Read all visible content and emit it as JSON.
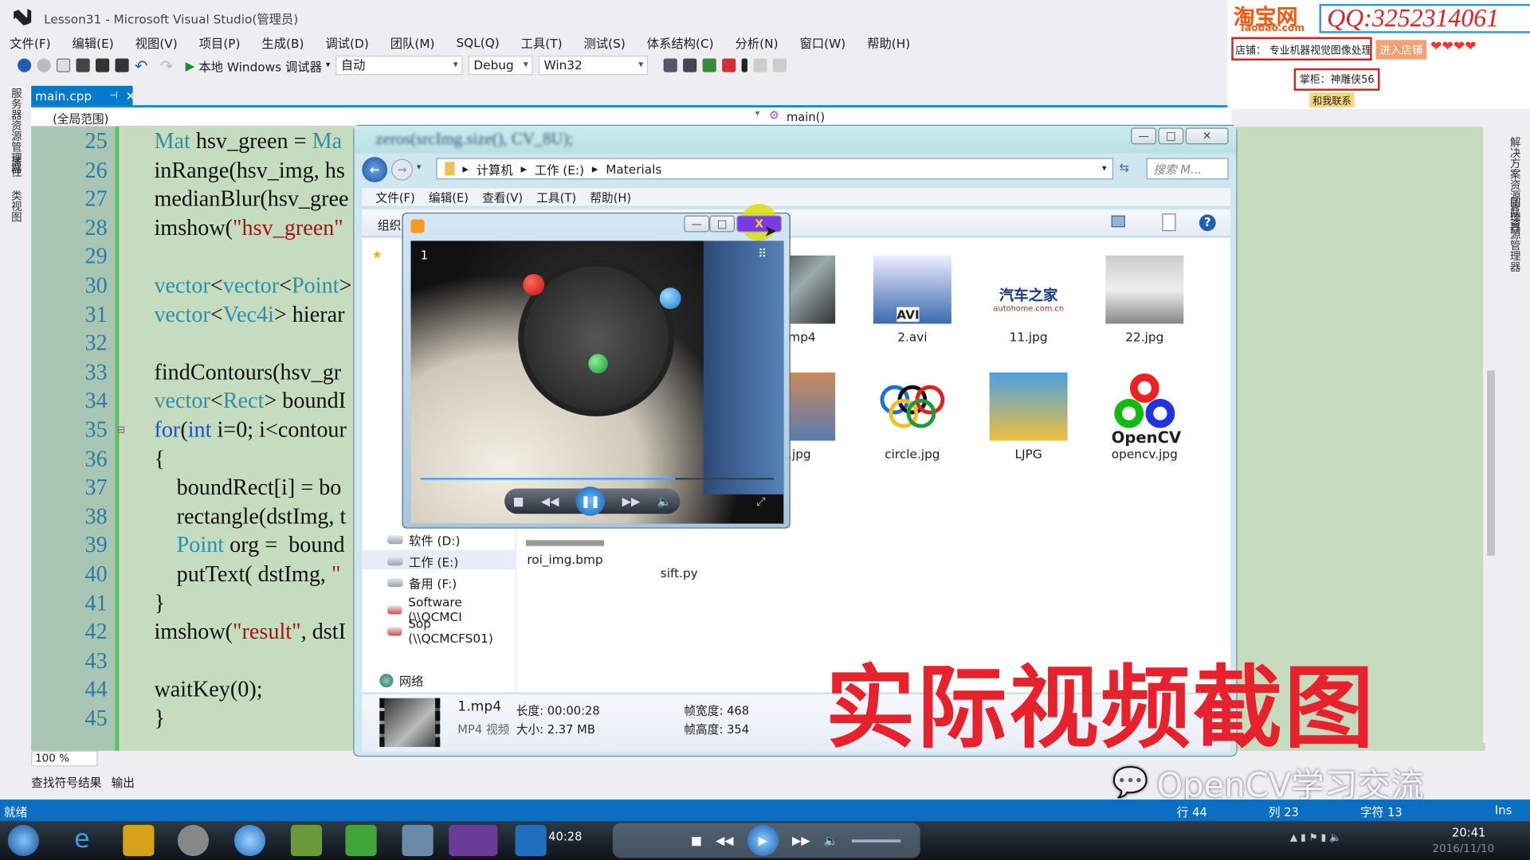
{
  "window": {
    "title": "Lesson31 - Microsoft Visual Studio(管理员)"
  },
  "menu": [
    "文件(F)",
    "编辑(E)",
    "视图(V)",
    "项目(P)",
    "生成(B)",
    "调试(D)",
    "团队(M)",
    "SQL(Q)",
    "工具(T)",
    "测试(S)",
    "体系结构(C)",
    "分析(N)",
    "窗口(W)",
    "帮助(H)"
  ],
  "toolbar": {
    "debugger_label": "本地 Windows 调试器",
    "config_combo": "自动",
    "build_combo": "Debug",
    "platform_combo": "Win32"
  },
  "doc_tab": {
    "label": "main.cpp",
    "pin": "⊣",
    "close": "✕"
  },
  "navbar": {
    "scope": "(全局范围)",
    "member": "main()"
  },
  "left_tabs": [
    "服务器资源管理器",
    "属性",
    "类视图"
  ],
  "right_tabs": [
    "解决方案资源管理器",
    "团队资源管理器",
    "类视图"
  ],
  "editor": {
    "lines": [
      {
        "n": "25",
        "segs": [
          [
            "Mat",
            "ty"
          ],
          [
            " hsv_green = ",
            ""
          ],
          [
            "Ma",
            "ty"
          ]
        ]
      },
      {
        "n": "26",
        "segs": [
          [
            "inRange(hsv_img, hs",
            ""
          ]
        ]
      },
      {
        "n": "27",
        "segs": [
          [
            "medianBlur(hsv_gree",
            ""
          ]
        ]
      },
      {
        "n": "28",
        "segs": [
          [
            "imshow(",
            ""
          ],
          [
            "\"hsv_green\"",
            "st"
          ]
        ]
      },
      {
        "n": "29",
        "segs": []
      },
      {
        "n": "30",
        "segs": [
          [
            "vector",
            "ty"
          ],
          [
            "<",
            ""
          ],
          [
            "vector",
            "ty"
          ],
          [
            "<",
            ""
          ],
          [
            "Point",
            "ty"
          ],
          [
            ">",
            ""
          ]
        ]
      },
      {
        "n": "31",
        "segs": [
          [
            "vector",
            "ty"
          ],
          [
            "<",
            ""
          ],
          [
            "Vec4i",
            "ty"
          ],
          [
            "> hierar",
            ""
          ]
        ]
      },
      {
        "n": "32",
        "segs": []
      },
      {
        "n": "33",
        "segs": [
          [
            "findContours(hsv_gr",
            ""
          ]
        ]
      },
      {
        "n": "34",
        "segs": [
          [
            "vector",
            "ty"
          ],
          [
            "<",
            ""
          ],
          [
            "Rect",
            "ty"
          ],
          [
            "> boundI",
            ""
          ]
        ]
      },
      {
        "n": "35",
        "segs": [
          [
            "for",
            "kw"
          ],
          [
            "(",
            ""
          ],
          [
            "int",
            "kw"
          ],
          [
            " i=0; i<contour",
            ""
          ]
        ]
      },
      {
        "n": "36",
        "segs": [
          [
            "{",
            ""
          ]
        ]
      },
      {
        "n": "37",
        "segs": [
          [
            "    boundRect[i] = bo",
            ""
          ]
        ]
      },
      {
        "n": "38",
        "segs": [
          [
            "    rectangle(dstImg, t",
            ""
          ]
        ]
      },
      {
        "n": "39",
        "segs": [
          [
            "    ",
            ""
          ],
          [
            "Point",
            "ty"
          ],
          [
            " org =  bound",
            ""
          ]
        ]
      },
      {
        "n": "40",
        "segs": [
          [
            "    putText( dstImg, ",
            ""
          ],
          [
            "\"",
            "st"
          ]
        ]
      },
      {
        "n": "41",
        "segs": [
          [
            "}",
            ""
          ]
        ]
      },
      {
        "n": "42",
        "segs": [
          [
            "imshow(",
            ""
          ],
          [
            "\"result\"",
            "st"
          ],
          [
            ", dstI",
            ""
          ]
        ]
      },
      {
        "n": "43",
        "segs": []
      },
      {
        "n": "44",
        "segs": [
          [
            "waitKey(0);",
            ""
          ]
        ]
      },
      {
        "n": "45",
        "segs": [
          [
            "}",
            ""
          ]
        ]
      }
    ],
    "zoom": "100 %"
  },
  "bottom_tabs": [
    "查找符号结果",
    "输出"
  ],
  "statusbar": {
    "ready": "就绪",
    "line": "行 44",
    "col": "列 23",
    "char": "字符 13",
    "mode": "Ins"
  },
  "explorer": {
    "title_blur": "zeros(srcImg.size(), CV_8U);",
    "breadcrumb": [
      "计算机",
      "工作 (E:)",
      "Materials"
    ],
    "search_placeholder": "搜索 M...",
    "menu": [
      "文件(F)",
      "编辑(E)",
      "查看(V)",
      "工具(T)",
      "帮助(H)"
    ],
    "organize": "组织",
    "nav": [
      {
        "label": "软件 (D:)",
        "icon": "drive"
      },
      {
        "label": "工作 (E:)",
        "icon": "drive",
        "selected": true
      },
      {
        "label": "备用 (F:)",
        "icon": "drive"
      },
      {
        "label": "Software (\\\\QCMCI",
        "icon": "network-drive-disconnected"
      },
      {
        "label": "Sop (\\\\QCMCFS01)",
        "icon": "network-drive-disconnected"
      }
    ],
    "network": "网络",
    "files": [
      {
        "name": "1.mp4",
        "kind": "video"
      },
      {
        "name": "2.avi",
        "kind": "avi"
      },
      {
        "name": "11.jpg",
        "kind": "autohome"
      },
      {
        "name": "22.jpg",
        "kind": "car"
      },
      {
        "name": "c.jpg",
        "kind": "photo"
      },
      {
        "name": "circle.jpg",
        "kind": "rings"
      },
      {
        "name": "LJPG",
        "kind": "cartoon"
      },
      {
        "name": "opencv.jpg",
        "kind": "opencv"
      },
      {
        "name": "roi_img.bmp",
        "kind": "bmp"
      },
      {
        "name": "sift.py",
        "kind": "python"
      }
    ],
    "autohome_text": "汽车之家",
    "autohome_sub": "autohome.com.cn",
    "avi_label": "AVI",
    "opencv_label": "OpenCV",
    "details": {
      "name": "1.mp4",
      "type": "MP4 视频",
      "length": "长度: 00:00:28",
      "size": "大小: 2.37 MB",
      "width": "帧宽度: 468",
      "height": "帧高度: 354"
    }
  },
  "player": {
    "track_no": "1",
    "progress": 0.72
  },
  "overlay": {
    "caption": "实际视频截图",
    "watermark": "OpenCV学习交流"
  },
  "ad": {
    "taobao": "淘宝网",
    "taobao_en": "Taobao.com",
    "qq": "QQ:3252314061",
    "shop": "店铺： 专业机器视觉图像处理",
    "enter": "进入店铺",
    "owner": "掌柜：神雕侠56",
    "contact": "和我联系"
  },
  "taskbar": {
    "media_time": "40:28",
    "clock": "20:41",
    "date": "2016/11/10"
  },
  "colors": {
    "vs_blue": "#007acc",
    "caption_red": "#e8222c",
    "editor_bg": "#c6dcbe"
  }
}
